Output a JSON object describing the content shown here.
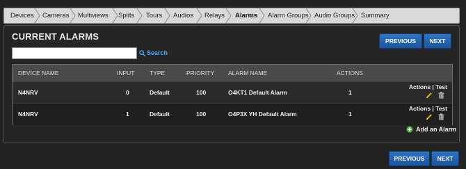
{
  "breadcrumb": {
    "items": [
      "Devices",
      "Cameras",
      "Multiviews",
      "Splits",
      "Tours",
      "Audios",
      "Relays",
      "Alarms",
      "Alarm Groups",
      "Audio Groups",
      "Summary"
    ],
    "active": "Alarms"
  },
  "page": {
    "title": "CURRENT ALARMS"
  },
  "nav": {
    "previous_label": "PREVIOUS",
    "next_label": "NEXT"
  },
  "search": {
    "value": "",
    "placeholder": "",
    "link_label": "Search"
  },
  "table": {
    "headers": {
      "device": "DEVICE NAME",
      "input": "INPUT",
      "type": "TYPE",
      "priority": "PRIORITY",
      "alarm": "ALARM NAME",
      "actions": "ACTIONS"
    },
    "rows": [
      {
        "device": "N4NRV",
        "input": "0",
        "type": "Default",
        "priority": "100",
        "alarm": "O4KT1 Default Alarm",
        "actions": "1",
        "links": "Actions | Test"
      },
      {
        "device": "N4NRV",
        "input": "1",
        "type": "Default",
        "priority": "100",
        "alarm": "O4P3X YH Default Alarm",
        "actions": "1",
        "links": "Actions | Test"
      }
    ]
  },
  "add": {
    "label": "Add an Alarm"
  },
  "colors": {
    "button": "#1f5fae",
    "link": "#4aa6ff",
    "add_icon": "#4caf3a",
    "edit_icon": "#e0b000"
  }
}
